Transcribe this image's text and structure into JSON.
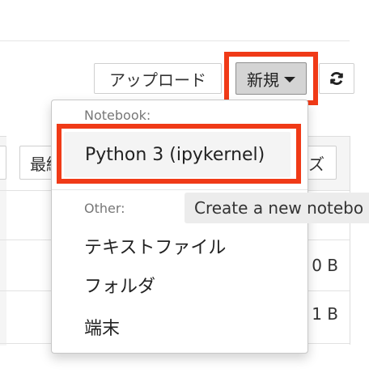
{
  "toolbar": {
    "upload_label": "アップロード",
    "new_label": "新規",
    "new_caret_icon": "caret-down-icon",
    "refresh_icon": "refresh-icon",
    "highlight_color": "#f03a17"
  },
  "file_list": {
    "sort_button_label": "最終",
    "size_button_label": "ズ",
    "rows": [
      {
        "size": "0 B"
      },
      {
        "size": "1 B"
      }
    ]
  },
  "new_menu": {
    "notebook_header": "Notebook:",
    "notebook_items": [
      "Python 3 (ipykernel)"
    ],
    "other_header": "Other:",
    "other_items": [
      "テキストファイル",
      "フォルダ",
      "端末"
    ]
  },
  "tooltip": {
    "text": "Create a new notebo"
  }
}
